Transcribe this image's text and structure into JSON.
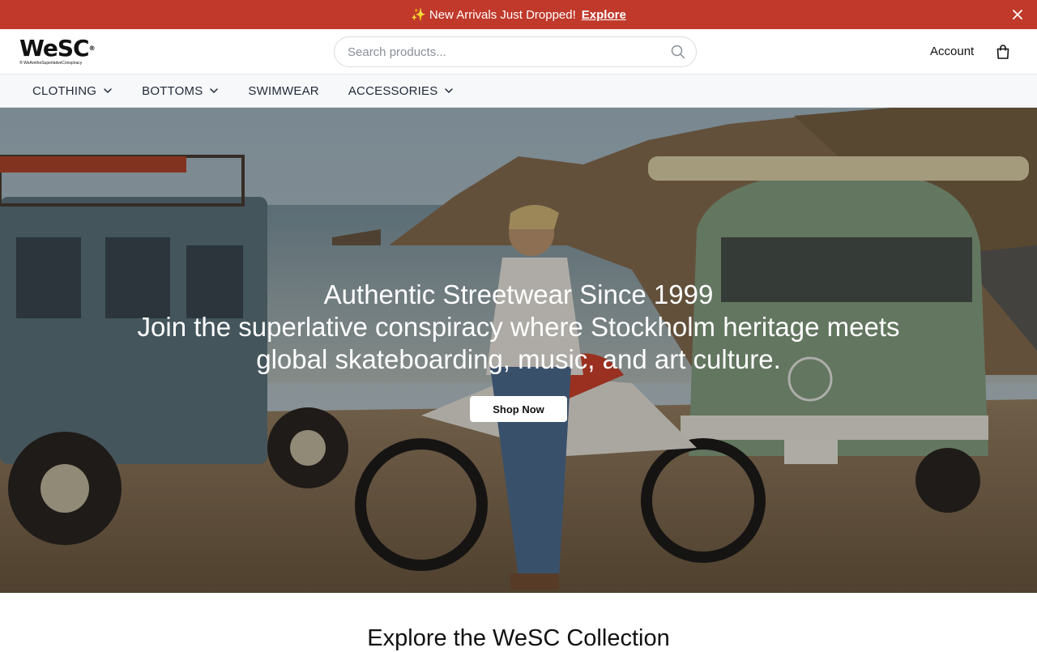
{
  "announcement": {
    "sparkle": "✨",
    "text": "New Arrivals Just Dropped!",
    "link": "Explore",
    "close_icon": "close-icon",
    "background": "#c0392b"
  },
  "header": {
    "logo_word": "WeSC",
    "logo_tagline": "WeAretheSuperlativeConspiracy",
    "search_placeholder": "Search products...",
    "search_icon": "search-icon",
    "account_label": "Account",
    "bag_icon": "shopping-bag-icon"
  },
  "nav": {
    "items": [
      {
        "label": "CLOTHING",
        "has_dropdown": true
      },
      {
        "label": "BOTTOMS",
        "has_dropdown": true
      },
      {
        "label": "SWIMWEAR",
        "has_dropdown": false
      },
      {
        "label": "ACCESSORIES",
        "has_dropdown": true
      }
    ]
  },
  "hero": {
    "title": "Authentic Streetwear Since 1999",
    "subtitle": "Join the superlative conspiracy where Stockholm heritage meets global skateboarding, music, and art culture.",
    "button_label": "Shop Now"
  },
  "section": {
    "title": "Explore the WeSC Collection"
  }
}
